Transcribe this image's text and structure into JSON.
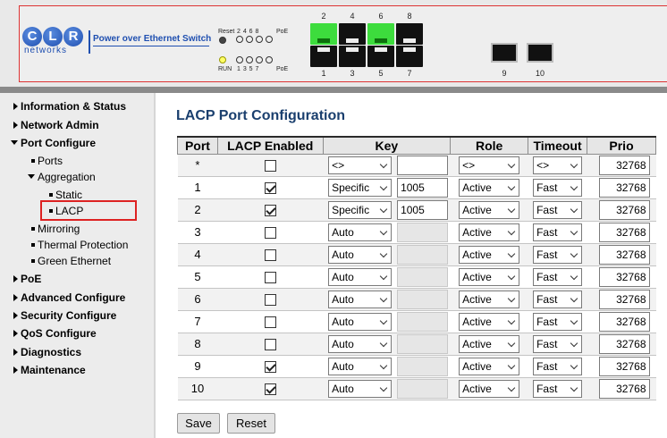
{
  "header": {
    "logo_letters": [
      "C",
      "L",
      "R"
    ],
    "logo_sub": "networks",
    "product_name": "Power over Ethernet Switch",
    "led_top": {
      "label_left": "Reset",
      "nums": "2 4 6 8",
      "label_right": "PoE"
    },
    "led_bottom": {
      "label_left": "RUN",
      "nums": "1 3 5 7",
      "label_right": "PoE"
    },
    "ports_top": [
      "2",
      "4",
      "6",
      "8"
    ],
    "ports_bottom": [
      "1",
      "3",
      "5",
      "7"
    ],
    "sfp_ports": [
      "9",
      "10"
    ],
    "colors": {
      "link_up": "#3ddc3d",
      "brand": "#1f4fb0",
      "frame": "#d33333"
    }
  },
  "sidebar": {
    "items": [
      {
        "label": "Information & Status"
      },
      {
        "label": "Network Admin"
      },
      {
        "label": "Port Configure",
        "expanded": true
      },
      {
        "label": "Ports"
      },
      {
        "label": "Aggregation",
        "expanded": true
      },
      {
        "label": "Static"
      },
      {
        "label": "LACP",
        "selected": true
      },
      {
        "label": "Mirroring"
      },
      {
        "label": "Thermal Protection"
      },
      {
        "label": "Green Ethernet"
      },
      {
        "label": "PoE"
      },
      {
        "label": "Advanced Configure"
      },
      {
        "label": "Security Configure"
      },
      {
        "label": "QoS Configure"
      },
      {
        "label": "Diagnostics"
      },
      {
        "label": "Maintenance"
      }
    ]
  },
  "main": {
    "title": "LACP Port Configuration",
    "columns": [
      "Port",
      "LACP Enabled",
      "Key",
      "Role",
      "Timeout",
      "Prio"
    ],
    "rows": [
      {
        "port": "*",
        "lacp": false,
        "key_mode": "<>",
        "key_value": "",
        "key_editable": true,
        "role": "<>",
        "timeout": "<>",
        "prio": "32768"
      },
      {
        "port": "1",
        "lacp": true,
        "key_mode": "Specific",
        "key_value": "1005",
        "key_editable": true,
        "role": "Active",
        "timeout": "Fast",
        "prio": "32768"
      },
      {
        "port": "2",
        "lacp": true,
        "key_mode": "Specific",
        "key_value": "1005",
        "key_editable": true,
        "role": "Active",
        "timeout": "Fast",
        "prio": "32768"
      },
      {
        "port": "3",
        "lacp": false,
        "key_mode": "Auto",
        "key_value": "",
        "key_editable": false,
        "role": "Active",
        "timeout": "Fast",
        "prio": "32768"
      },
      {
        "port": "4",
        "lacp": false,
        "key_mode": "Auto",
        "key_value": "",
        "key_editable": false,
        "role": "Active",
        "timeout": "Fast",
        "prio": "32768"
      },
      {
        "port": "5",
        "lacp": false,
        "key_mode": "Auto",
        "key_value": "",
        "key_editable": false,
        "role": "Active",
        "timeout": "Fast",
        "prio": "32768"
      },
      {
        "port": "6",
        "lacp": false,
        "key_mode": "Auto",
        "key_value": "",
        "key_editable": false,
        "role": "Active",
        "timeout": "Fast",
        "prio": "32768"
      },
      {
        "port": "7",
        "lacp": false,
        "key_mode": "Auto",
        "key_value": "",
        "key_editable": false,
        "role": "Active",
        "timeout": "Fast",
        "prio": "32768"
      },
      {
        "port": "8",
        "lacp": false,
        "key_mode": "Auto",
        "key_value": "",
        "key_editable": false,
        "role": "Active",
        "timeout": "Fast",
        "prio": "32768"
      },
      {
        "port": "9",
        "lacp": true,
        "key_mode": "Auto",
        "key_value": "",
        "key_editable": false,
        "role": "Active",
        "timeout": "Fast",
        "prio": "32768"
      },
      {
        "port": "10",
        "lacp": true,
        "key_mode": "Auto",
        "key_value": "",
        "key_editable": false,
        "role": "Active",
        "timeout": "Fast",
        "prio": "32768"
      }
    ],
    "buttons": {
      "save": "Save",
      "reset": "Reset"
    }
  }
}
